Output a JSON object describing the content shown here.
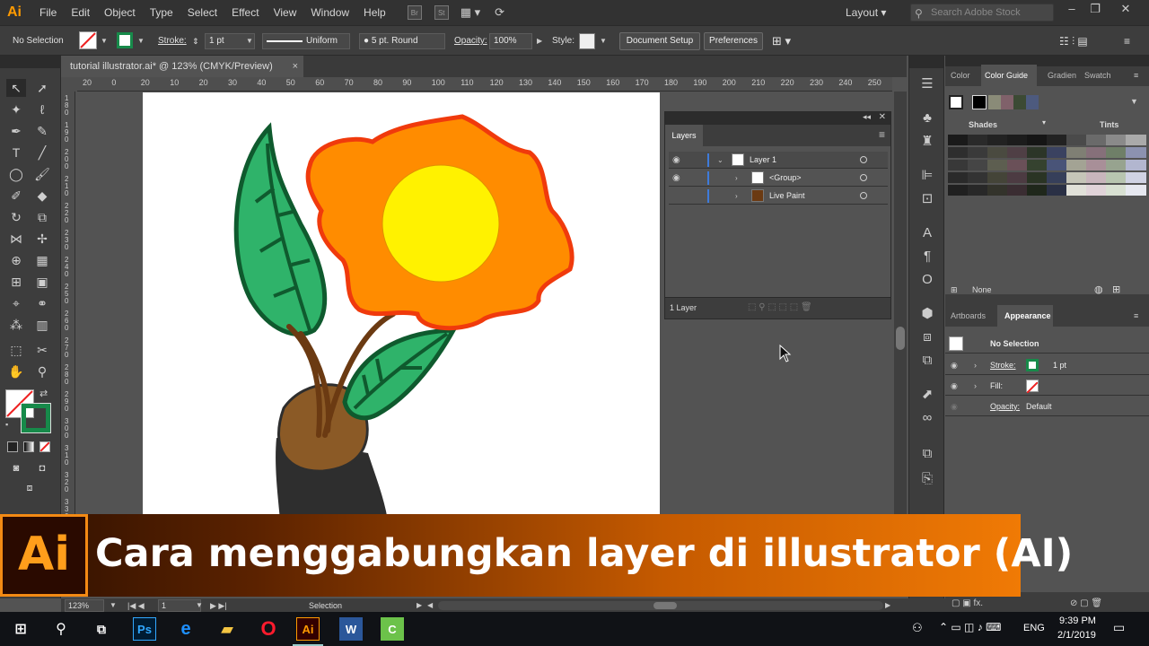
{
  "app": {
    "logo": "Ai",
    "menus": [
      "File",
      "Edit",
      "Object",
      "Type",
      "Select",
      "Effect",
      "View",
      "Window",
      "Help"
    ],
    "bridge": "Br",
    "stock": "St",
    "layout": "Layout",
    "search_placeholder": "Search Adobe Stock"
  },
  "control": {
    "selection": "No Selection",
    "stroke_label": "Stroke:",
    "stroke_value": "1 pt",
    "profile": "Uniform",
    "brush": "5 pt. Round",
    "opacity_label": "Opacity:",
    "opacity_value": "100%",
    "style_label": "Style:",
    "doc_setup": "Document Setup",
    "preferences": "Preferences"
  },
  "document": {
    "tab_title": "tutorial illustrator.ai* @ 123% (CMYK/Preview)",
    "close": "×"
  },
  "ruler": {
    "h_ticks": [
      "20",
      "0",
      "20",
      "10",
      "20",
      "30",
      "40",
      "50",
      "60",
      "70",
      "80",
      "90",
      "100",
      "110",
      "120",
      "130",
      "140",
      "150",
      "160",
      "170",
      "180",
      "190",
      "200",
      "210",
      "220",
      "230",
      "240",
      "250"
    ],
    "v_ticks": [
      "1\n8\n0",
      "1\n9\n0",
      "2\n0\n0",
      "2\n1\n0",
      "2\n2\n0",
      "2\n3\n0",
      "2\n4\n0",
      "2\n5\n0",
      "2\n6\n0",
      "2\n7\n0",
      "2\n8\n0",
      "2\n9\n0",
      "3\n0\n0",
      "3\n1\n0",
      "3\n2\n0",
      "3\n3\n0"
    ]
  },
  "layers": {
    "tab": "Layers",
    "rows": [
      {
        "name": "Layer 1"
      },
      {
        "name": "<Group>"
      },
      {
        "name": "Live Paint"
      }
    ],
    "footer": "1 Layer"
  },
  "right": {
    "tabs": [
      "Color",
      "Color Guide",
      "Gradien",
      "Swatch"
    ],
    "shades": "Shades",
    "tints": "Tints",
    "none": "None",
    "tabs2": [
      "Artboards",
      "Appearance"
    ],
    "app_title": "No Selection",
    "stroke_label": "Stroke:",
    "stroke_value": "1 pt",
    "fill_label": "Fill:",
    "opacity_label": "Opacity:",
    "opacity_value": "Default"
  },
  "statusbar": {
    "zoom": "123%",
    "page": "1",
    "tool": "Selection"
  },
  "banner": {
    "logo": "Ai",
    "title": "Cara menggabungkan layer di illustrator (AI)"
  },
  "taskbar": {
    "lang": "ENG",
    "time": "9:39 PM",
    "date": "2/1/2019",
    "apps": [
      "Ps",
      "e",
      "folder",
      "O",
      "Ai",
      "W",
      "C"
    ]
  },
  "colors": {
    "accent": "#ff9a00",
    "petal": "#ff8c00",
    "petal_outline": "#f03a0c",
    "center": "#fff200",
    "leaf": "#2fb36a",
    "leaf_outline": "#0f5a2e",
    "stem": "#6b3a12",
    "pot": "#8b5a26",
    "pot_dark": "#2e2e2e"
  }
}
